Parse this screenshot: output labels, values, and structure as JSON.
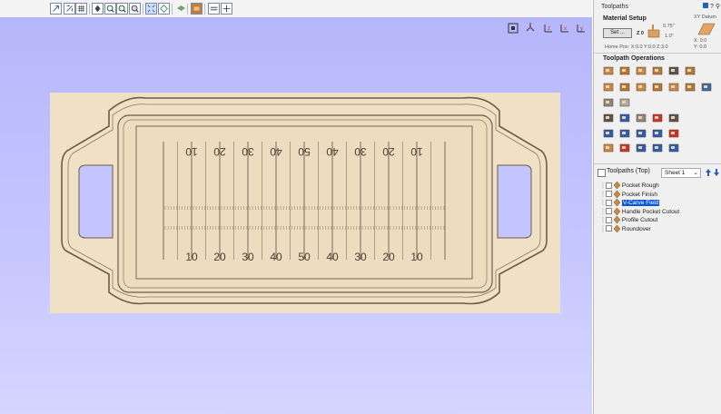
{
  "panel": {
    "title": "Toolpaths",
    "top_icons": "?",
    "material_setup": {
      "heading": "Material Setup",
      "set_label": "Set ...",
      "thickness_top": "0.75\"",
      "thickness_bottom": "1.0\"",
      "z_label": "Z 0",
      "home_pos": "Home Pos:  X:0.0 Y:0.0 Z:3.0",
      "xy_datum_label": "XY Datum",
      "xy_x": "X: 0.0",
      "xy_y": "Y: 0.0"
    },
    "operations_heading": "Toolpath Operations",
    "toolpaths_header": "Toolpaths (Top)",
    "sheet_select": "Sheet 1",
    "toolpaths": [
      {
        "label": "Pocket Rough",
        "selected": false
      },
      {
        "label": "Pocket Finish",
        "selected": false
      },
      {
        "label": "V-Carve Field",
        "selected": true
      },
      {
        "label": "Handle Pocket Cutout",
        "selected": false
      },
      {
        "label": "Profile Cutout",
        "selected": false
      },
      {
        "label": "Roundover",
        "selected": false
      }
    ]
  },
  "field": {
    "top_numbers": [
      "10",
      "20",
      "30",
      "40",
      "50",
      "40",
      "30",
      "20",
      "10"
    ],
    "bottom_numbers": [
      "10",
      "20",
      "30",
      "40",
      "50",
      "40",
      "30",
      "20",
      "10"
    ]
  },
  "colors": {
    "wood": "#efe0c6",
    "wood_line": "#6d5d49",
    "view_bg": "#bcbcfc",
    "selection": "#0a58d6"
  }
}
